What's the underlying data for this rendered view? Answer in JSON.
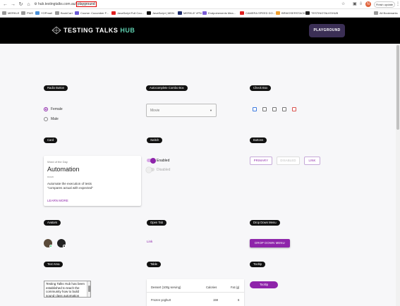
{
  "browser": {
    "url_prefix": "hub.testingtalks.com.au/",
    "url_path": "playground",
    "update_label": "Finish update",
    "profile_initial": "N",
    "bookmarks": [
      "MERKLE",
      "PWE",
      "YOPmail",
      "BookCart",
      "Course: Cucumber F...",
      "JavaScript Full Cou...",
      "JavaScript | MDN",
      "MERKLE VPN",
      "Endpoinenents Mea...",
      "CAMERA SPEED DO...",
      "BRWOSERSTACK",
      "TESTINGTALKSHUB"
    ],
    "all_bookmarks": "All Bookmarks"
  },
  "header": {
    "logo_main": "TESTING TALKS ",
    "logo_accent": "HUB",
    "playground_label": "PLAYGROUND"
  },
  "sections": {
    "radio": "Radio Button",
    "autocomplete": "Autocomplete Combo Box",
    "checkbox": "Check Box",
    "card": "Card",
    "switch": "Switch",
    "buttons": "Buttons",
    "avatars": "Avatars",
    "open_tab": "Open Tab",
    "dropdown": "Drop Down Menu",
    "textarea": "Text Area",
    "table": "Table",
    "tooltip": "Tooltip"
  },
  "radio": {
    "options": [
      "Female",
      "Male"
    ],
    "selected": "Female"
  },
  "combo": {
    "placeholder": "Movie"
  },
  "checkbox_colors": [
    "#3f7be0",
    "#777777",
    "#777777",
    "#777777",
    "#d9534f"
  ],
  "card": {
    "overline": "Word of the Day",
    "title": "Automation",
    "pos": "noun",
    "body_line1": "Automate the execution of tests",
    "body_line2": "\"compares actual with expected\"",
    "action": "LEARN MORE"
  },
  "switch": {
    "enabled_label": "Enabled",
    "disabled_label": "Disabled"
  },
  "buttons": {
    "primary": "PRIMARY",
    "disabled": "DISABLED",
    "link": "LINK"
  },
  "open_tab": {
    "link": "Link"
  },
  "dropdown": {
    "button": "DROP DOWN MENU"
  },
  "textarea": {
    "value": "Testing Talks Hub has been established to teach the community how to build sound class automation frameworks"
  },
  "table": {
    "headers": [
      "Dessert (100g serving)",
      "Calories",
      "Fat (g)"
    ],
    "rows": [
      [
        "Frozen yoghurt",
        "159",
        "6"
      ]
    ]
  },
  "tooltip": {
    "button": "Tooltip"
  },
  "colors": {
    "accent": "#8e24aa",
    "header_bg": "#000000",
    "playground_bg": "#3b2f55",
    "hub_green": "#5fd0b0"
  }
}
